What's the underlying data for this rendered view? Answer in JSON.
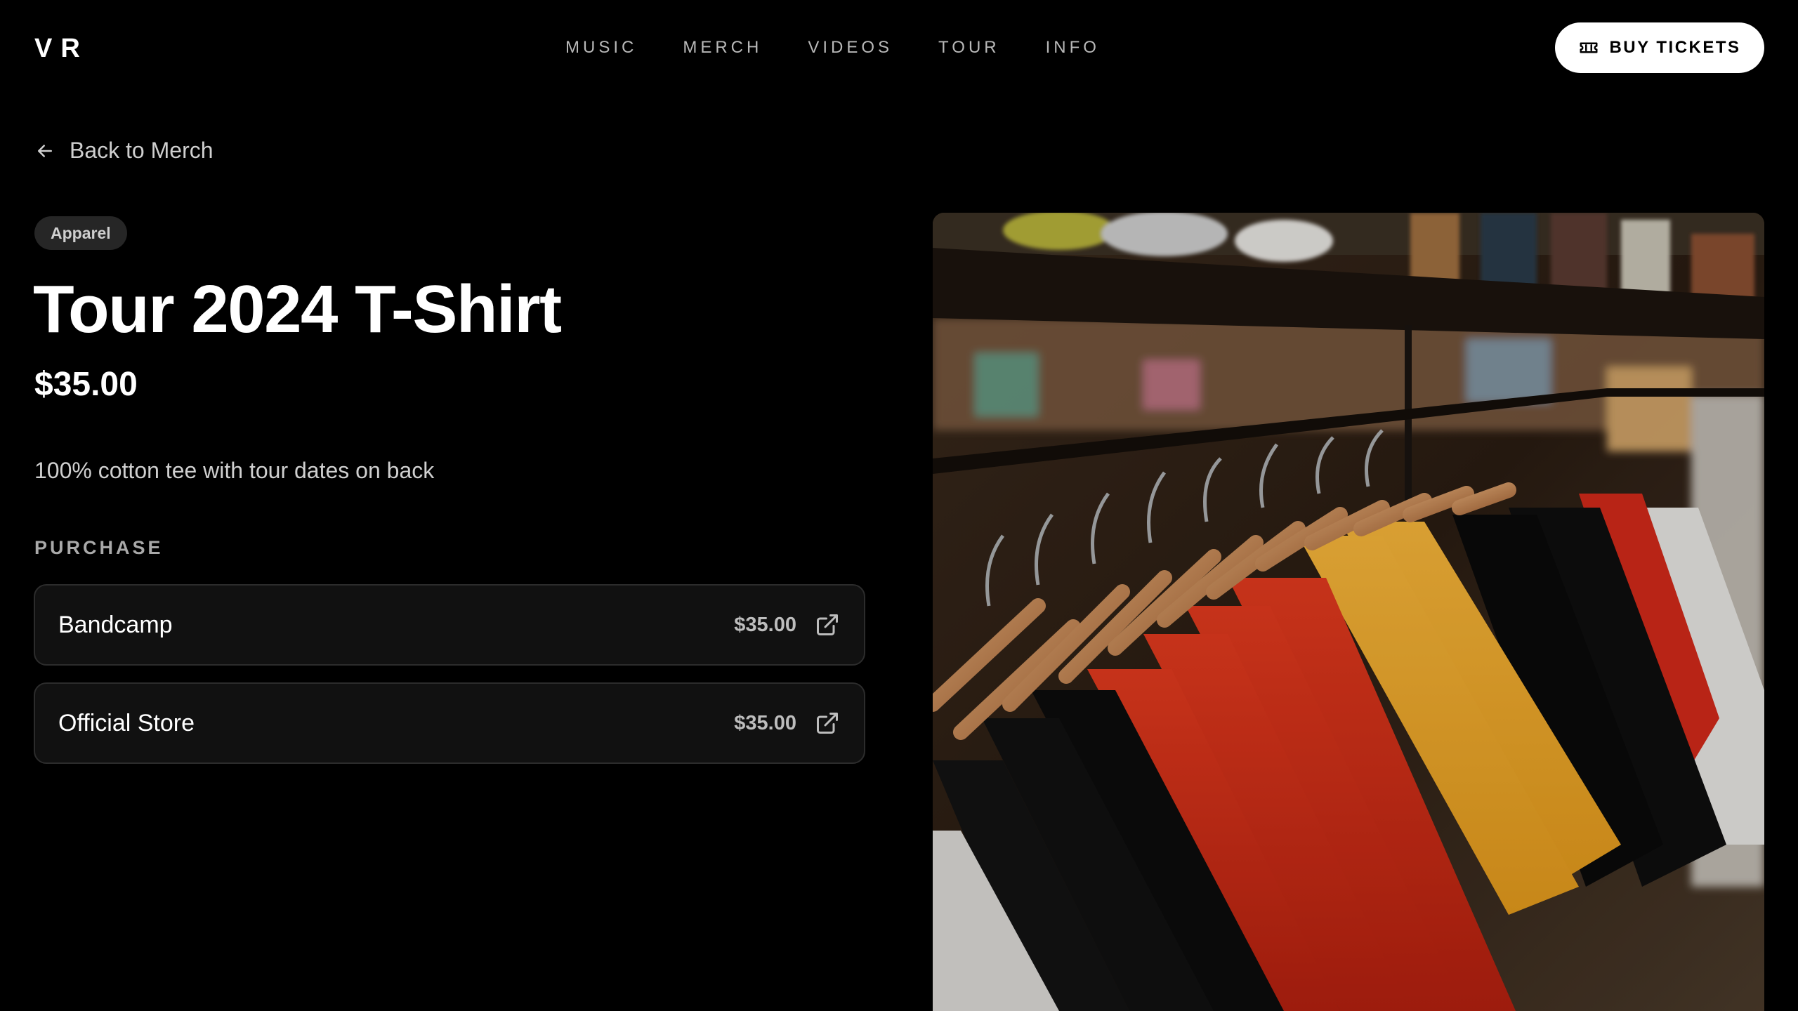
{
  "header": {
    "logo": "VR",
    "nav": [
      {
        "label": "MUSIC"
      },
      {
        "label": "MERCH"
      },
      {
        "label": "VIDEOS"
      },
      {
        "label": "TOUR"
      },
      {
        "label": "INFO"
      }
    ],
    "buy_tickets_label": "BUY TICKETS"
  },
  "back_link": {
    "label": "Back to Merch"
  },
  "product": {
    "category": "Apparel",
    "title": "Tour 2024 T-Shirt",
    "price": "$35.00",
    "description": "100% cotton tee with tour dates on back"
  },
  "purchase": {
    "section_label": "PURCHASE",
    "stores": [
      {
        "name": "Bandcamp",
        "price": "$35.00",
        "icon": "external-link-icon"
      },
      {
        "name": "Official Store",
        "price": "$35.00",
        "icon": "external-link-icon"
      }
    ]
  },
  "icons": {
    "ticket": "ticket-icon",
    "back": "arrow-left-icon"
  }
}
